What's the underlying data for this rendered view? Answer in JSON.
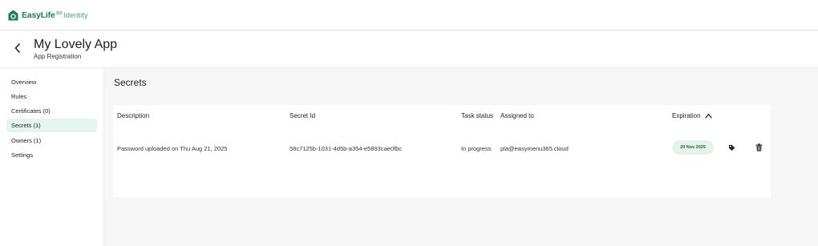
{
  "topbar": {
    "brand": "EasyLife",
    "brand_sup": "365",
    "brand_suffix": "Identity"
  },
  "header": {
    "title": "My Lovely App",
    "subtitle": "App Registration"
  },
  "sidebar": {
    "items": [
      {
        "label": "Overview"
      },
      {
        "label": "Rules"
      },
      {
        "label": "Certificates (0)"
      },
      {
        "label": "Secrets (1)"
      },
      {
        "label": "Owners (1)"
      },
      {
        "label": "Settings"
      }
    ],
    "active": "Secrets (1)"
  },
  "main": {
    "title": "Secrets",
    "table": {
      "headers": {
        "description": "Description",
        "secret_id": "Secret Id",
        "task_status": "Task status",
        "assigned_to": "Assigned to",
        "expiration": "Expiration"
      },
      "rows": [
        {
          "description": "Password uploaded on Thu Aug 21, 2025",
          "secret_id": "58c7125b-1031-4d5b-a354-e5893cae0fbc",
          "task_status": "In progress",
          "assigned_to": "pla@easymenu365.cloud",
          "expiration": "20 Nov 2025"
        }
      ]
    }
  },
  "colors": {
    "accent": "#1e7a5c",
    "active_nav": "#e4f4ee",
    "badge_bg": "#e7f3ea",
    "badge_text": "#1c6a35"
  },
  "icons": [
    "house-logo-icon",
    "back-arrow-icon",
    "sort-ascending-icon",
    "tag-icon",
    "trash-icon"
  ]
}
